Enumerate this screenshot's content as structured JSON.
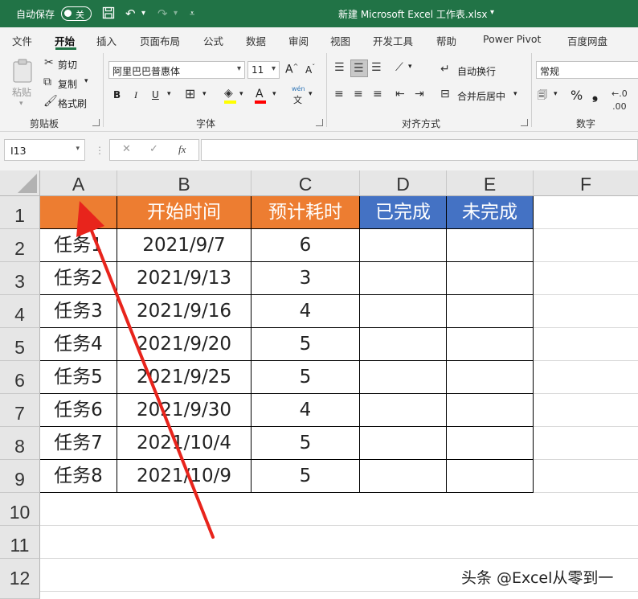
{
  "titlebar": {
    "autosave_label": "自动保存",
    "autosave_state": "关",
    "file_title": "新建 Microsoft Excel 工作表.xlsx",
    "title_dropdown_icon": "▾",
    "bg_color": "#217346"
  },
  "ribbon_tabs": [
    "文件",
    "开始",
    "插入",
    "页面布局",
    "公式",
    "数据",
    "审阅",
    "视图",
    "开发工具",
    "帮助",
    "Power Pivot",
    "百度网盘"
  ],
  "active_tab": "开始",
  "ribbon": {
    "clipboard": {
      "group_label": "剪贴板",
      "paste_label": "粘贴",
      "cut_label": "剪切",
      "copy_label": "复制",
      "format_painter_label": "格式刷"
    },
    "font": {
      "group_label": "字体",
      "font_name": "阿里巴巴普惠体",
      "font_size": "11",
      "bold": "B",
      "italic": "I",
      "underline": "U",
      "grow": "A",
      "shrink": "A",
      "font_color_letter": "A",
      "wen_pinyin": "wén",
      "wen_char": "文"
    },
    "alignment": {
      "group_label": "对齐方式",
      "wrap_text_label": "自动换行",
      "merge_center_label": "合并后居中"
    },
    "number": {
      "group_label": "数字",
      "format_value": "常规",
      "percent": "%",
      "comma": "❟"
    }
  },
  "formula_bar": {
    "name_box": "I13",
    "fx": "fx",
    "cancel": "✕",
    "enter": "✓",
    "formula_value": ""
  },
  "sheet": {
    "columns": [
      "A",
      "B",
      "C",
      "D",
      "E",
      "F"
    ],
    "rows": [
      "1",
      "2",
      "3",
      "4",
      "5",
      "6",
      "7",
      "8",
      "9",
      "10",
      "11",
      "12"
    ],
    "header_row": [
      "",
      "开始时间",
      "预计耗时",
      "已完成",
      "未完成"
    ],
    "data": [
      [
        "任务1",
        "2021/9/7",
        "6",
        "",
        ""
      ],
      [
        "任务2",
        "2021/9/13",
        "3",
        "",
        ""
      ],
      [
        "任务3",
        "2021/9/16",
        "4",
        "",
        ""
      ],
      [
        "任务4",
        "2021/9/20",
        "5",
        "",
        ""
      ],
      [
        "任务5",
        "2021/9/25",
        "5",
        "",
        ""
      ],
      [
        "任务6",
        "2021/9/30",
        "4",
        "",
        ""
      ],
      [
        "任务7",
        "2021/10/4",
        "5",
        "",
        ""
      ],
      [
        "任务8",
        "2021/10/9",
        "5",
        "",
        ""
      ]
    ],
    "colors": {
      "orange": "#ed7d31",
      "blue": "#4472c4",
      "arrow_red": "#e8241c"
    }
  },
  "watermark": "头条 @Excel从零到一"
}
